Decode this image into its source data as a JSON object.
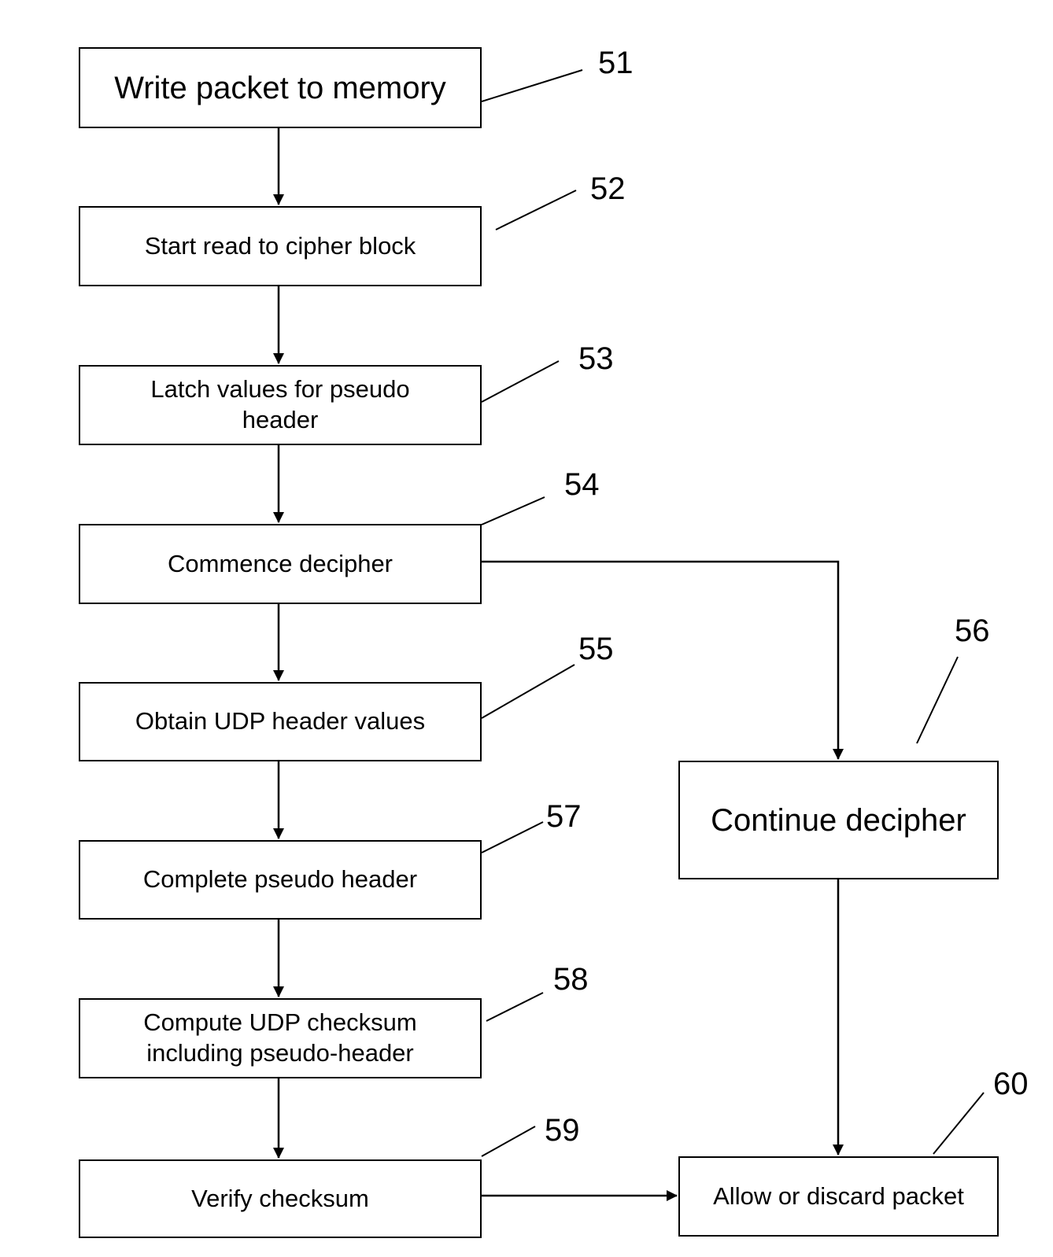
{
  "diagram": {
    "type": "flowchart",
    "steps": [
      {
        "id": "51",
        "label": "Write packet to memory"
      },
      {
        "id": "52",
        "label": "Start read to cipher block"
      },
      {
        "id": "53",
        "label": "Latch values for pseudo header"
      },
      {
        "id": "54",
        "label": "Commence decipher"
      },
      {
        "id": "55",
        "label": "Obtain UDP header values"
      },
      {
        "id": "56",
        "label": "Continue decipher"
      },
      {
        "id": "57",
        "label": "Complete pseudo header"
      },
      {
        "id": "58",
        "label": "Compute UDP checksum including pseudo-header"
      },
      {
        "id": "59",
        "label": "Verify checksum"
      },
      {
        "id": "60",
        "label": "Allow or discard packet"
      }
    ],
    "flows": [
      {
        "from": "51",
        "to": "52"
      },
      {
        "from": "52",
        "to": "53"
      },
      {
        "from": "53",
        "to": "54"
      },
      {
        "from": "54",
        "to": "55"
      },
      {
        "from": "54",
        "to": "56"
      },
      {
        "from": "55",
        "to": "57"
      },
      {
        "from": "57",
        "to": "58"
      },
      {
        "from": "58",
        "to": "59"
      },
      {
        "from": "59",
        "to": "60"
      },
      {
        "from": "56",
        "to": "60"
      }
    ]
  }
}
